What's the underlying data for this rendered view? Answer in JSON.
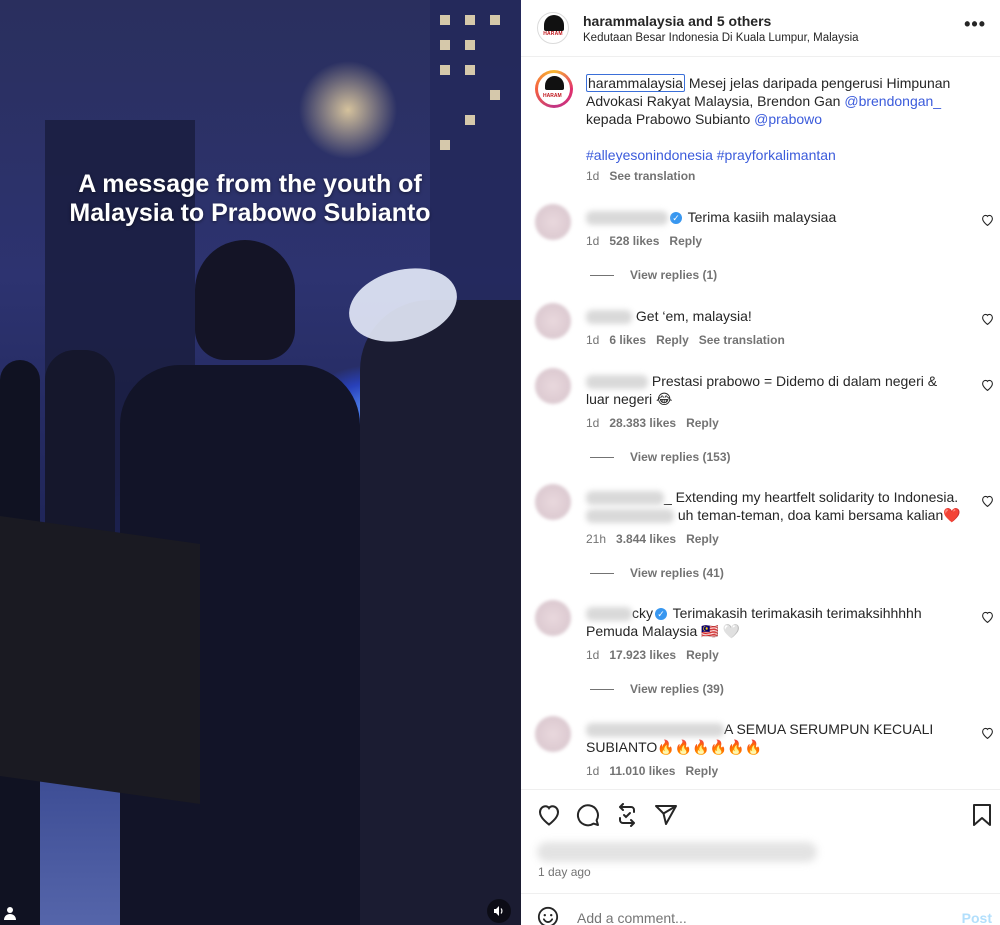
{
  "media": {
    "overlay_line1": "A message from the youth of",
    "overlay_line2": "Malaysia to Prabowo Subianto",
    "user_icon": "user-tag-icon",
    "volume_icon": "speaker-icon"
  },
  "header": {
    "username": "harammalaysia",
    "others": "and 5 others",
    "location": "Kedutaan Besar Indonesia Di Kuala Lumpur, Malaysia",
    "more": "•••",
    "logo_text": "HARAM"
  },
  "caption": {
    "username": "harammalaysia",
    "text1": " Mesej jelas daripada pengerusi Himpunan Advokasi Rakyat Malaysia, Brendon Gan ",
    "mention1": "@brendongan_",
    "text2": " kepada Prabowo Subianto ",
    "mention2": "@prabowo",
    "hashtag1": "#alleyesonindonesia",
    "hashtag2": "#prayforkalimantan",
    "time": "1d",
    "see_translation": "See translation"
  },
  "comments": [
    {
      "name_suffix": "",
      "verified": true,
      "text": "Terima kasiih malaysiaa",
      "text_cont": "",
      "time": "1d",
      "likes": "528 likes",
      "reply": "Reply",
      "translation": "",
      "replies": "View replies (1)"
    },
    {
      "name_suffix": "",
      "verified": false,
      "text": "Get ‘em, malaysia!",
      "text_cont": "",
      "time": "1d",
      "likes": "6 likes",
      "reply": "Reply",
      "translation": "See translation",
      "replies": ""
    },
    {
      "name_suffix": "",
      "verified": false,
      "text": "Prestasi prabowo = Didemo di dalam negeri &",
      "text_cont": "luar negeri 😂",
      "time": "1d",
      "likes": "28.383 likes",
      "reply": "Reply",
      "translation": "",
      "replies": "View replies (153)"
    },
    {
      "name_suffix": "_",
      "verified": false,
      "text": " Extending my heartfelt solidarity to Indonesia.",
      "text_cont": "uh teman-teman, doa kami bersama kalian❤️",
      "time": "21h",
      "likes": "3.844 likes",
      "reply": "Reply",
      "translation": "",
      "replies": "View replies (41)"
    },
    {
      "name_suffix": "cky",
      "verified": true,
      "text": " Terimakasih terimakasih terimaksihhhhh",
      "text_cont": "Pemuda Malaysia 🇲🇾 🤍",
      "time": "1d",
      "likes": "17.923 likes",
      "reply": "Reply",
      "translation": "",
      "replies": "View replies (39)"
    },
    {
      "name_suffix": "",
      "verified": false,
      "text": "A SEMUA SERUMPUN KECUALI",
      "text_cont": "SUBIANTO🔥🔥🔥🔥🔥🔥",
      "time": "1d",
      "likes": "11.010 likes",
      "reply": "Reply",
      "translation": "",
      "replies": ""
    }
  ],
  "actions": {
    "like_icon": "heart-icon",
    "comment_icon": "comment-icon",
    "repost_icon": "repost-icon",
    "share_icon": "share-icon",
    "save_icon": "bookmark-icon",
    "time_ago": "1 day ago"
  },
  "add_comment": {
    "placeholder": "Add a comment...",
    "post": "Post",
    "emoji_icon": "emoji-icon"
  }
}
